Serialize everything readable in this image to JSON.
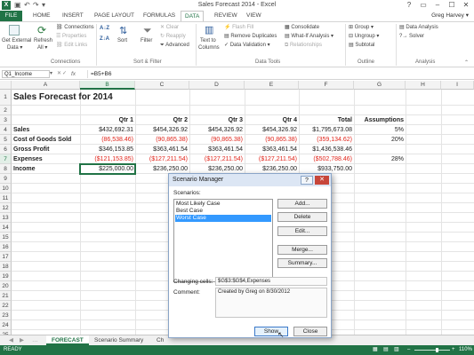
{
  "window": {
    "title": "Sales Forecast 2014 - Excel",
    "app_icon": "X",
    "controls": [
      "?",
      "▭",
      "–",
      "☐",
      "✕"
    ]
  },
  "ribbon_tabs": [
    "FILE",
    "HOME",
    "INSERT",
    "PAGE LAYOUT",
    "FORMULAS",
    "DATA",
    "REVIEW",
    "VIEW"
  ],
  "user": "Greg Harvey ▾",
  "ribbon": {
    "get_external": "Get External",
    "get_external2": "Data ▾",
    "refresh": "Refresh",
    "refresh2": "All ▾",
    "connections": "Connections",
    "properties": "Properties",
    "edit_links": "Edit Links",
    "sort_az": "A↓Z",
    "sort_za": "Z↓A",
    "sort": "Sort",
    "filter": "Filter",
    "clear": "Clear",
    "reapply": "Reapply",
    "advanced": "Advanced",
    "text_to_columns": "Text to",
    "text_to_columns2": "Columns",
    "flash_fill": "Flash Fill",
    "remove_duplicates": "Remove Duplicates",
    "data_validation": "Data Validation ▾",
    "consolidate": "Consolidate",
    "what_if": "What-If Analysis ▾",
    "relationships": "Relationships",
    "group": "Group ▾",
    "ungroup": "Ungroup ▾",
    "subtotal": "Subtotal",
    "data_analysis": "Data Analysis",
    "solver": "Solver",
    "groups": [
      "Connections",
      "Sort & Filter",
      "Data Tools",
      "Outline",
      "Analysis"
    ]
  },
  "formula_bar": {
    "name_box": "Q1_Income",
    "fx": "fx",
    "formula": "=B5+B6"
  },
  "columns": [
    "A",
    "B",
    "C",
    "D",
    "E",
    "F",
    "G",
    "H",
    "I"
  ],
  "rows": [
    "1",
    "2",
    "3",
    "4",
    "5",
    "6",
    "7",
    "8",
    "9",
    "10",
    "11",
    "12",
    "13",
    "14",
    "15",
    "16",
    "17",
    "18",
    "19",
    "20",
    "21",
    "22",
    "23",
    "24",
    "25"
  ],
  "sheet": {
    "title": "Sales Forecast for 2014",
    "headers": [
      "Qtr 1",
      "Qtr 2",
      "Qtr 3",
      "Qtr 4",
      "Total",
      "Assumptions"
    ],
    "table": [
      {
        "label": "Sales",
        "values": [
          "$432,692.31",
          "$454,326.92",
          "$454,326.92",
          "$454,326.92",
          "$1,795,673.08"
        ],
        "assumption": "5%"
      },
      {
        "label": "Cost of Goods Sold",
        "values": [
          "(86,538.46)",
          "(90,865.38)",
          "(90,865.38)",
          "(90,865.38)",
          "(359,134.62)"
        ],
        "assumption": "20%"
      },
      {
        "label": "Gross Profit",
        "values": [
          "$346,153.85",
          "$363,461.54",
          "$363,461.54",
          "$363,461.54",
          "$1,436,538.46"
        ],
        "assumption": ""
      },
      {
        "label": "Expenses",
        "values": [
          "($121,153.85)",
          "($127,211.54)",
          "($127,211.54)",
          "($127,211.54)",
          "($502,788.46)"
        ],
        "assumption": "28%"
      },
      {
        "label": "Income",
        "values": [
          "$225,000.00",
          "$236,250.00",
          "$236,250.00",
          "$236,250.00",
          "$933,750.00"
        ],
        "assumption": ""
      }
    ]
  },
  "sheet_tabs": [
    "FORECAST",
    "Scenario Summary",
    "Ch"
  ],
  "status": {
    "ready": "READY",
    "zoom": "110%"
  },
  "dialog": {
    "title": "Scenario Manager",
    "scenarios_label": "Scenarios:",
    "scenarios": [
      "Most Likely Case",
      "Best Case",
      "Worst Case"
    ],
    "selected_index": 2,
    "buttons": [
      "Add...",
      "Delete",
      "Edit...",
      "Merge...",
      "Summary..."
    ],
    "changing_cells_label": "Changing cells:",
    "changing_cells": "$G$3:$G$4,Expenses",
    "comment_label": "Comment:",
    "comment": "Created by Greg on 8/30/2012",
    "show": "Show",
    "close": "Close",
    "help": "?",
    "x": "✕"
  },
  "colors": {
    "excel_green": "#217346",
    "negative_red": "#e0251b",
    "selection_blue": "#3399ff"
  }
}
